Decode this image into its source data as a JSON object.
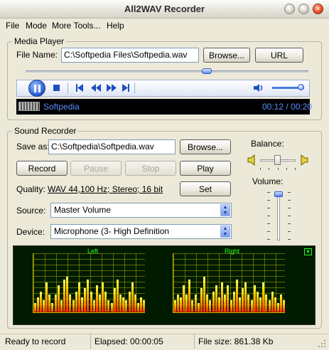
{
  "window": {
    "title": "All2WAV Recorder"
  },
  "menu": {
    "items": [
      "File",
      "Mode",
      "More Tools...",
      "Help"
    ]
  },
  "media_player": {
    "group_label": "Media Player",
    "file_name_label": "File Name:",
    "file_name_value": "C:\\Softpedia Files\\Softpedia.wav",
    "browse_label": "Browse...",
    "url_label": "URL",
    "track_title": "Softpedia",
    "time_display": "00:12 / 00:20",
    "progress": 0.64,
    "volume": 0.9
  },
  "sound_recorder": {
    "group_label": "Sound Recorder",
    "save_as_label": "Save as:",
    "save_as_value": "C:\\Softpedia\\Softpedia.wav",
    "browse_label": "Browse...",
    "record_label": "Record",
    "pause_label": "Pause",
    "stop_label": "Stop",
    "play_label": "Play",
    "quality_label": "Quality:",
    "quality_value": "WAV 44,100 Hz; Stereo; 16 bit",
    "set_label": "Set",
    "source_label": "Source:",
    "source_value": "Master Volume",
    "device_label": "Device:",
    "device_value": "Microphone (3- High Definition",
    "balance_label": "Balance:",
    "volume_label": "Volume:",
    "balance": 0.5,
    "volume": 0.95
  },
  "visualizer": {
    "left_label": "Left",
    "right_label": "Right",
    "left_levels": [
      0.15,
      0.25,
      0.35,
      0.2,
      0.5,
      0.3,
      0.15,
      0.3,
      0.45,
      0.2,
      0.55,
      0.6,
      0.3,
      0.2,
      0.35,
      0.5,
      0.25,
      0.4,
      0.55,
      0.35,
      0.2,
      0.45,
      0.3,
      0.5,
      0.35,
      0.2,
      0.15,
      0.4,
      0.55,
      0.3,
      0.25,
      0.2,
      0.35,
      0.5,
      0.3,
      0.15,
      0.25,
      0.2
    ],
    "right_levels": [
      0.2,
      0.3,
      0.25,
      0.45,
      0.3,
      0.55,
      0.2,
      0.3,
      0.15,
      0.4,
      0.6,
      0.3,
      0.2,
      0.35,
      0.45,
      0.25,
      0.5,
      0.3,
      0.45,
      0.2,
      0.35,
      0.55,
      0.25,
      0.4,
      0.5,
      0.3,
      0.2,
      0.45,
      0.35,
      0.25,
      0.5,
      0.3,
      0.2,
      0.35,
      0.25,
      0.15,
      0.3,
      0.2
    ]
  },
  "statusbar": {
    "status": "Ready to record",
    "elapsed": "Elapsed: 00:00:05",
    "file_size": "File size: 861.38 Kb"
  }
}
